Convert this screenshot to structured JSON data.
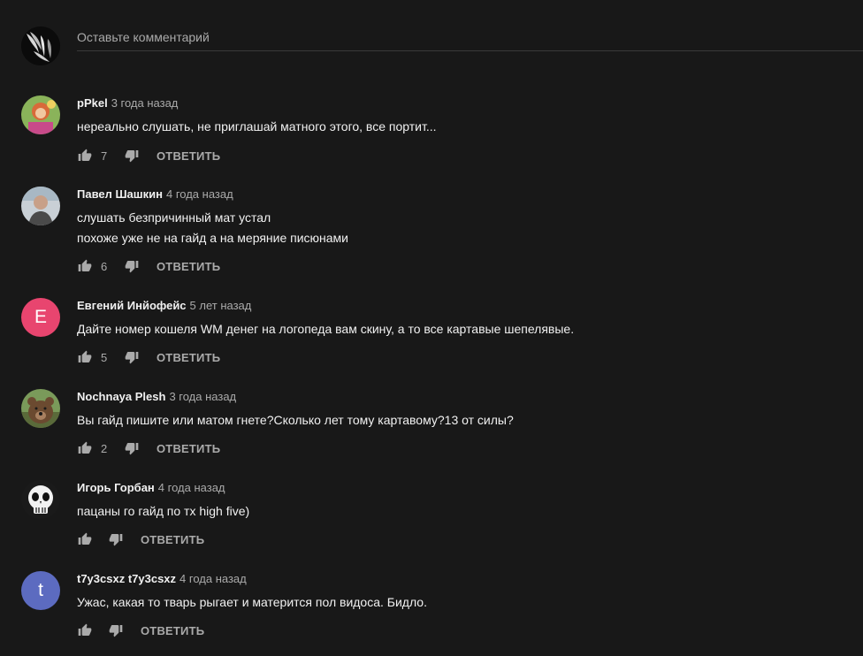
{
  "composer": {
    "placeholder": "Оставьте комментарий"
  },
  "reply_label": "ОТВЕТИТЬ",
  "comments": [
    {
      "author": "pPkel",
      "time": "3 года назад",
      "lines": [
        "нереально слушать, не приглашай матного этого, все портит..."
      ],
      "likes": "7"
    },
    {
      "author": "Павел Шашкин",
      "time": "4 года назад",
      "lines": [
        "слушать безпричинный мат устал",
        "похоже уже не на гайд а на меряние писюнами"
      ],
      "likes": "6"
    },
    {
      "author": "Евгений Инйофейс",
      "time": "5 лет назад",
      "lines": [
        "Дайте номер кошеля WM денег на логопеда вам скину, а то все картавые шепелявые."
      ],
      "likes": "5",
      "avatar_letter": "E",
      "avatar_color": "#e8456f"
    },
    {
      "author": "Nochnaya Plesh",
      "time": "3 года назад",
      "lines": [
        "Вы гайд пишите или матом гнете?Сколько лет тому картавому?13 от силы?"
      ],
      "likes": "2"
    },
    {
      "author": "Игорь Горбан",
      "time": "4 года назад",
      "lines": [
        "пацаны го гайд по тх high five)"
      ],
      "likes": ""
    },
    {
      "author": "t7y3csxz t7y3csxz",
      "time": "4 года назад",
      "lines": [
        "Ужас, какая то тварь рыгает и матерится пол видоса. Бидло."
      ],
      "likes": "",
      "avatar_letter": "t",
      "avatar_color": "#5c6bc0"
    }
  ]
}
